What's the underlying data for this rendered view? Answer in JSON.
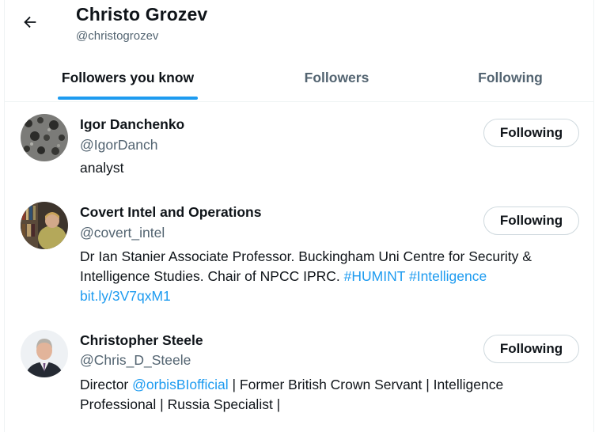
{
  "header": {
    "name": "Christo Grozev",
    "handle": "@christogrozev"
  },
  "tabs": [
    {
      "label": "Followers you know",
      "active": true
    },
    {
      "label": "Followers",
      "active": false
    },
    {
      "label": "Following",
      "active": false
    }
  ],
  "users": [
    {
      "name": "Igor Danchenko",
      "handle": "@IgorDanch",
      "button": "Following",
      "bio": {
        "text": "analyst"
      }
    },
    {
      "name": "Covert Intel and Operations",
      "handle": "@covert_intel",
      "button": "Following",
      "bio": {
        "text_1": "Dr Ian Stanier Associate Professor. Buckingham Uni Centre for Security & Intelligence Studies. Chair of NPCC IPRC. ",
        "link_1": "#HUMINT",
        "text_2": " ",
        "link_2": "#Intelligence",
        "link_3": "bit.ly/3V7qxM1"
      }
    },
    {
      "name": "Christopher Steele",
      "handle": "@Chris_D_Steele",
      "button": "Following",
      "bio": {
        "text_1": "Director ",
        "link_1": "@orbisBIofficial",
        "text_2": " | Former British Crown Servant | Intelligence Professional | Russia Specialist |"
      }
    }
  ],
  "colors": {
    "accent": "#1d9bf0",
    "text_primary": "#0f1419",
    "text_secondary": "#536471",
    "border": "#cfd9de"
  },
  "icons": {
    "back": "arrow-left-icon"
  }
}
